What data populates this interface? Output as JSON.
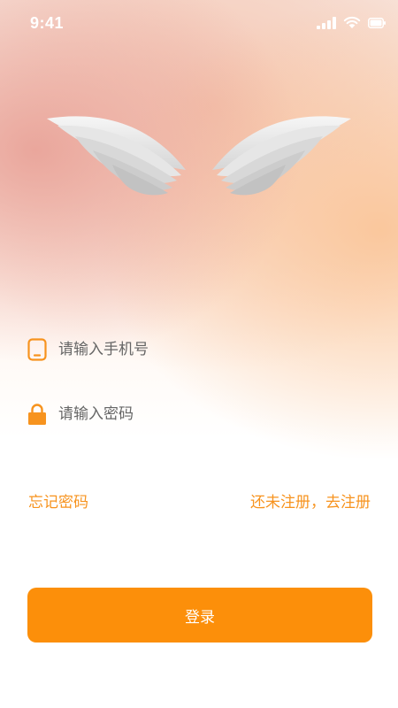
{
  "status_bar": {
    "time": "9:41",
    "icons": [
      "signal-icon",
      "wifi-icon",
      "battery-icon"
    ]
  },
  "hero": {
    "image": "angel-wings"
  },
  "form": {
    "phone": {
      "placeholder": "请输入手机号",
      "value": "",
      "icon": "phone-icon"
    },
    "password": {
      "placeholder": "请输入密码",
      "value": "",
      "icon": "lock-icon"
    }
  },
  "links": {
    "forgot_password": "忘记密码",
    "register": "还未注册，去注册"
  },
  "login_button": {
    "label": "登录"
  },
  "colors": {
    "accent": "#fc8f0a",
    "link": "#f7931e",
    "wing": "#e3e3e3"
  }
}
